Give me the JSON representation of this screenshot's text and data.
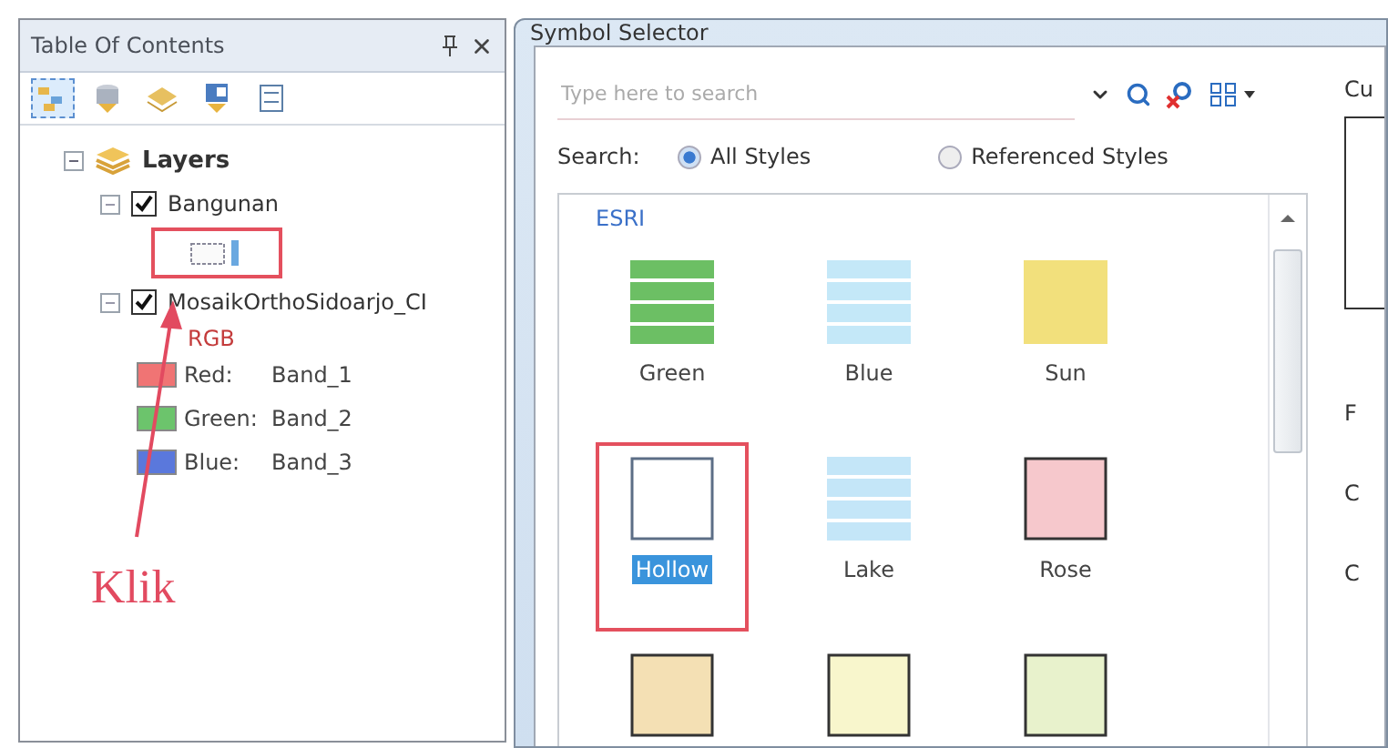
{
  "toc": {
    "title": "Table Of Contents",
    "toolbar": [
      {
        "kind": "order",
        "selected": true
      },
      {
        "kind": "source",
        "selected": false
      },
      {
        "kind": "visibility",
        "selected": false
      },
      {
        "kind": "selection",
        "selected": false
      },
      {
        "kind": "options",
        "selected": false
      }
    ],
    "tree": {
      "label": "Layers",
      "expanded": true,
      "children": [
        {
          "label": "Bangunan",
          "checked": true,
          "expanded": true,
          "annotated": true
        },
        {
          "label": "MosaikOrthoSidoarjo_CI",
          "checked": true,
          "expanded": true,
          "legend_title": "RGB",
          "bands": [
            {
              "label": "Red:",
              "value": "Band_1",
              "color": "#f07474"
            },
            {
              "label": "Green:",
              "value": "Band_2",
              "color": "#6cc46c"
            },
            {
              "label": "Blue:",
              "value": "Band_3",
              "color": "#5a78dc"
            }
          ]
        }
      ]
    }
  },
  "annotation": {
    "text": "Klik"
  },
  "dialog": {
    "title": "Symbol Selector",
    "search": {
      "placeholder": "Type here to search"
    },
    "search_label": "Search:",
    "scopes": [
      {
        "label": "All Styles",
        "selected": true
      },
      {
        "label": "Referenced Styles",
        "selected": false
      }
    ],
    "group": "ESRI",
    "symbols": [
      {
        "name": "Green",
        "kind": "bands",
        "color": "#6cbf64",
        "selected": false,
        "annotated": false
      },
      {
        "name": "Blue",
        "kind": "bands",
        "color": "#c4e8f8",
        "selected": false,
        "annotated": false
      },
      {
        "name": "Sun",
        "kind": "solid",
        "color": "#f2e07c",
        "selected": false,
        "annotated": false
      },
      {
        "name": "Hollow",
        "kind": "hollow",
        "color": "#5c6e86",
        "selected": true,
        "annotated": true
      },
      {
        "name": "Lake",
        "kind": "bands",
        "color": "#c4e6f8",
        "selected": false,
        "annotated": false
      },
      {
        "name": "Rose",
        "kind": "outlined",
        "color": "#f6c8cc",
        "selected": false,
        "annotated": false
      },
      {
        "kind": "outlined",
        "color": "#f4e0b4",
        "annotated": false
      },
      {
        "kind": "outlined",
        "color": "#f8f6cc",
        "annotated": false
      },
      {
        "kind": "outlined",
        "color": "#e8f2cc",
        "annotated": false
      }
    ],
    "side_label": "Cu",
    "side_cut_labels": [
      "F",
      "C",
      "C"
    ]
  }
}
